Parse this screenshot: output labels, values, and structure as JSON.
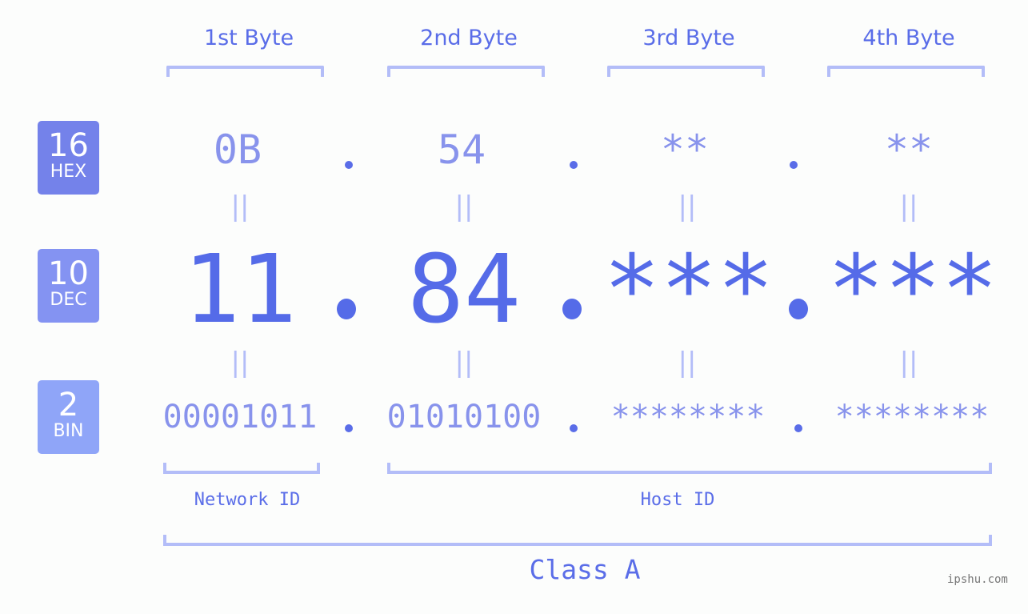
{
  "bytes": [
    {
      "label": "1st Byte",
      "hex": "0B",
      "dec": "11",
      "bin": "00001011"
    },
    {
      "label": "2nd Byte",
      "hex": "54",
      "dec": "84",
      "bin": "01010100"
    },
    {
      "label": "3rd Byte",
      "hex": "**",
      "dec": "***",
      "bin": "********"
    },
    {
      "label": "4th Byte",
      "hex": "**",
      "dec": "***",
      "bin": "********"
    }
  ],
  "rows": {
    "hex": {
      "base": "16",
      "name": "HEX"
    },
    "dec": {
      "base": "10",
      "name": "DEC"
    },
    "bin": {
      "base": "2",
      "name": "BIN"
    }
  },
  "equals_symbol": "||",
  "network_id_label": "Network ID",
  "host_id_label": "Host ID",
  "class_label": "Class A",
  "watermark": "ipshu.com",
  "colors": {
    "accent": "#5a6de8",
    "light_accent": "#8893ec",
    "bracket": "#b3bdf8",
    "hex_badge": "#7482ea",
    "dec_badge": "#8493f2",
    "bin_badge": "#8fa5f8"
  }
}
